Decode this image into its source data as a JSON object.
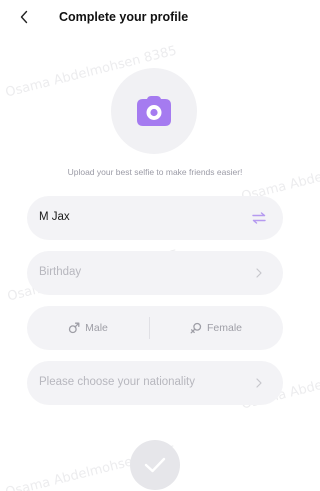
{
  "header": {
    "title": "Complete your profile",
    "back_icon": "chevron-left-icon"
  },
  "avatar": {
    "icon": "camera-icon",
    "accent": "#a57bf0"
  },
  "upload_hint": "Upload your best selfie to make friends easier!",
  "form": {
    "name": {
      "value": "M Jax",
      "icon": "swap-arrows-icon",
      "icon_color": "#b59af0"
    },
    "birthday": {
      "placeholder": "Birthday",
      "icon": "chevron-right-icon"
    },
    "gender": {
      "male_label": "Male",
      "female_label": "Female",
      "male_icon": "male-symbol-icon",
      "female_icon": "female-symbol-icon"
    },
    "nationality": {
      "placeholder": "Please choose your nationality",
      "icon": "chevron-right-icon"
    }
  },
  "submit": {
    "icon": "checkmark-icon"
  },
  "watermark": "Osama Abdelmohsen 8385"
}
